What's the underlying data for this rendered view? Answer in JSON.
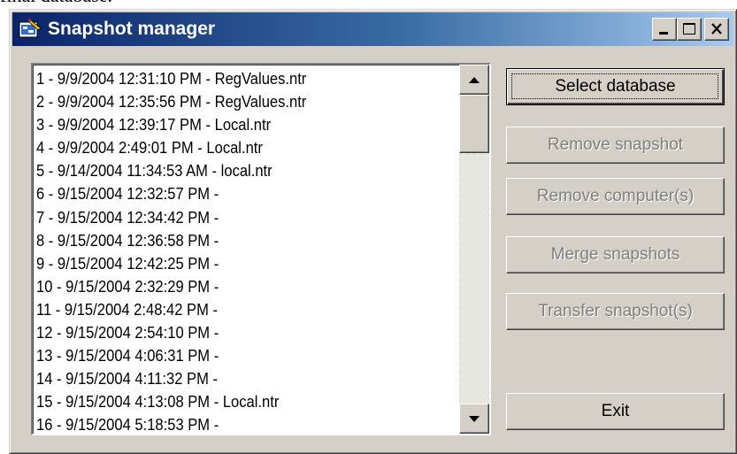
{
  "page_text": "final database.",
  "window": {
    "title": "Snapshot manager",
    "controls": {
      "minimize": "minimize-icon",
      "maximize": "maximize-icon",
      "close": "close-icon"
    }
  },
  "snapshots": [
    "1 - 9/9/2004 12:31:10 PM - RegValues.ntr",
    "2 - 9/9/2004 12:35:56 PM - RegValues.ntr",
    "3 - 9/9/2004 12:39:17 PM - Local.ntr",
    "4 - 9/9/2004 2:49:01 PM - Local.ntr",
    "5 - 9/14/2004 11:34:53 AM - local.ntr",
    "6 - 9/15/2004 12:32:57 PM -",
    "7 - 9/15/2004 12:34:42 PM -",
    "8 - 9/15/2004 12:36:58 PM -",
    "9 - 9/15/2004 12:42:25 PM -",
    "10 - 9/15/2004 2:32:29 PM -",
    "11 - 9/15/2004 2:48:42 PM -",
    "12 - 9/15/2004 2:54:10 PM -",
    "13 - 9/15/2004 4:06:31 PM -",
    "14 - 9/15/2004 4:11:32 PM -",
    "15 - 9/15/2004 4:13:08 PM - Local.ntr",
    "16 - 9/15/2004 5:18:53 PM -"
  ],
  "buttons": {
    "select_database": "Select database",
    "remove_snapshot": "Remove snapshot",
    "remove_computers": "Remove computer(s)",
    "merge_snapshots": "Merge snapshots",
    "transfer_snapshots": "Transfer snapshot(s)",
    "exit": "Exit"
  },
  "colors": {
    "title_gradient_start": "#0a246a",
    "title_gradient_end": "#a6caf0",
    "face": "#d4d0c8",
    "disabled_text": "#808080"
  }
}
